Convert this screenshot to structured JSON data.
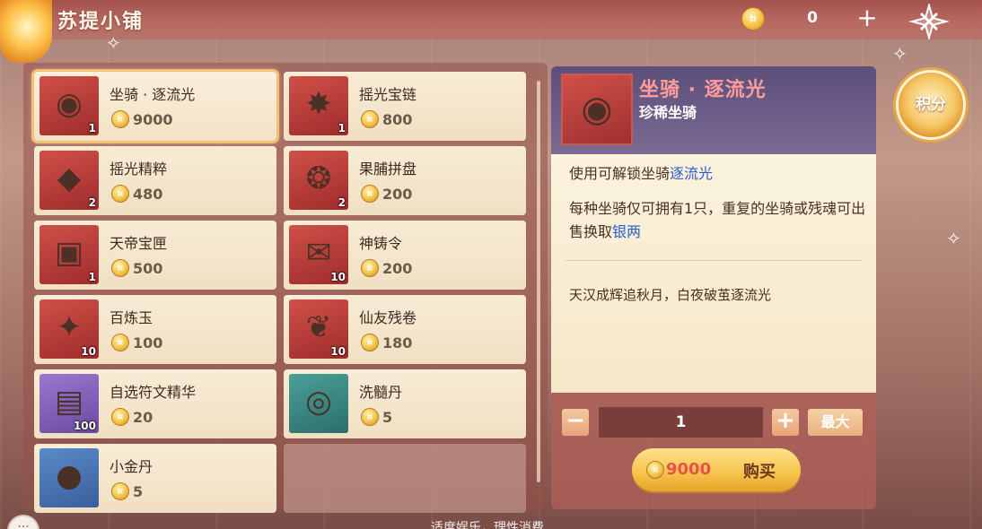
{
  "shop": {
    "title": "苏提小铺"
  },
  "currency": {
    "count": "0",
    "plus": "+"
  },
  "points": {
    "label": "积分"
  },
  "items": [
    {
      "name": "坐骑 · 逐流光",
      "price": "9000",
      "qty": "1",
      "icon": "mount-icon",
      "glyph": "◉",
      "tone": "t-red",
      "selected": true
    },
    {
      "name": "摇光宝链",
      "price": "800",
      "qty": "1",
      "icon": "chain-icon",
      "glyph": "✸",
      "tone": "t-red"
    },
    {
      "name": "摇光精粹",
      "price": "480",
      "qty": "2",
      "icon": "crystal-icon",
      "glyph": "◆",
      "tone": "t-red"
    },
    {
      "name": "果脯拼盘",
      "price": "200",
      "qty": "2",
      "icon": "fruit-platter-icon",
      "glyph": "❂",
      "tone": "t-red"
    },
    {
      "name": "天帝宝匣",
      "price": "500",
      "qty": "1",
      "icon": "treasure-chest-icon",
      "glyph": "▣",
      "tone": "t-red"
    },
    {
      "name": "神铸令",
      "price": "200",
      "qty": "10",
      "icon": "token-pouch-icon",
      "glyph": "✉",
      "tone": "t-red"
    },
    {
      "name": "百炼玉",
      "price": "100",
      "qty": "10",
      "icon": "jade-icon",
      "glyph": "✦",
      "tone": "t-red"
    },
    {
      "name": "仙友残卷",
      "price": "180",
      "qty": "10",
      "icon": "scroll-icon",
      "glyph": "❦",
      "tone": "t-red"
    },
    {
      "name": "自选符文精华",
      "price": "20",
      "qty": "100",
      "icon": "rune-box-icon",
      "glyph": "▤",
      "tone": "t-purple"
    },
    {
      "name": "洗髓丹",
      "price": "5",
      "qty": "",
      "icon": "pill-icon",
      "glyph": "◎",
      "tone": "t-teal"
    },
    {
      "name": "小金丹",
      "price": "5",
      "qty": "",
      "icon": "gold-pill-icon",
      "glyph": "●",
      "tone": "t-blue"
    }
  ],
  "detail": {
    "name": "坐骑 · 逐流光",
    "rarity": "珍稀坐骑",
    "line1_prefix": "使用可解锁坐骑",
    "line1_link": "逐流光",
    "line2_prefix": "每种坐骑仅可拥有1只，重复的坐骑或残魂可出售换取",
    "line2_link": "银两",
    "flavor": "天汉成辉追秋月，白夜破茧逐流光"
  },
  "purchase": {
    "quantity": "1",
    "minus": "−",
    "plus": "+",
    "max_label": "最大",
    "price": "9000",
    "buy_label": "购买"
  },
  "footer": {
    "text": "适度娱乐，理性消费"
  }
}
